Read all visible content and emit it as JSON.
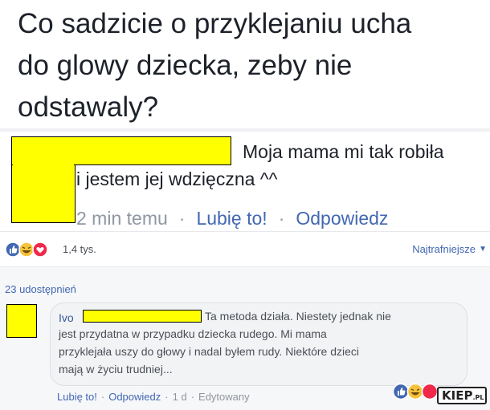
{
  "post": {
    "question_lines": [
      "Co sadzicie o przyklejaniu ucha",
      "do glowy dziecka, zeby nie",
      "odstawaly?"
    ]
  },
  "top_comment": {
    "text_line_1": "Moja mama mi tak robiła",
    "text_line_2": "i jestem jej wdzięczna ^^",
    "time": "2 min temu",
    "like_label": "Lubię to!",
    "reply_label": "Odpowiedz",
    "separator": "·"
  },
  "reactions": {
    "icons": [
      "like-icon",
      "haha-icon",
      "love-icon"
    ],
    "count": "1,4 tys.",
    "sort_label": "Najtrafniejsze",
    "sort_arrow": "▼",
    "colors": {
      "like": "#4267b2",
      "haha": "#f5c33b",
      "love": "#f0284a"
    }
  },
  "shares": {
    "label": "23 udostępnień"
  },
  "reply_comment": {
    "author": "Ivo",
    "lines": [
      "Ta metoda działa. Niestety jednak nie",
      "jest przydatna w przypadku dziecka rudego. Mi mama",
      "przyklejała uszy do głowy i nadal byłem rudy. Niektóre dzieci",
      "mają w życiu trudniej..."
    ],
    "like_label": "Lubię to!",
    "reply_label": "Odpowiedz",
    "time": "1 d",
    "edited_label": "Edytowany",
    "separator": "·"
  },
  "watermark": {
    "text": "KIEP",
    "suffix": ".PL"
  },
  "redaction_color": "#ffff00"
}
